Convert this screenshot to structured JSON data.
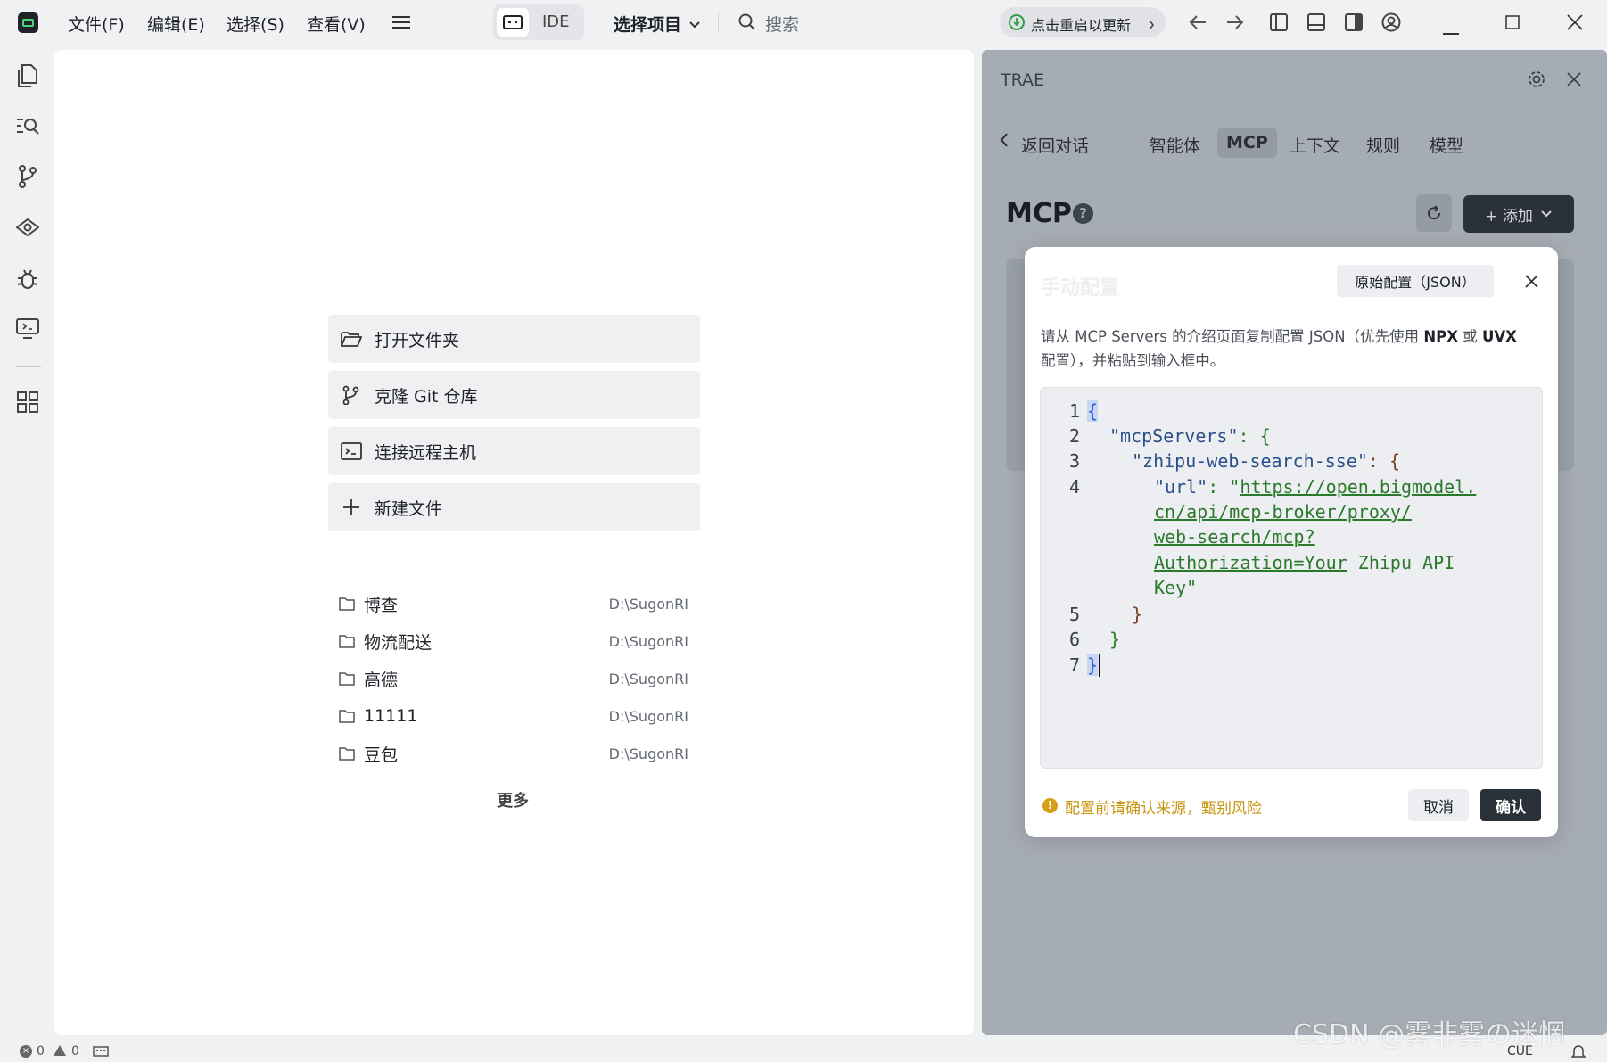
{
  "menu": {
    "file": "文件(F)",
    "edit": "编辑(E)",
    "select": "选择(S)",
    "view": "查看(V)"
  },
  "mode_switch": {
    "ide": "IDE"
  },
  "project_select": "选择项目",
  "search_placeholder": "搜索",
  "update_pill": "点击重启以更新",
  "editor": {
    "actions": [
      "打开文件夹",
      "克隆 Git 仓库",
      "连接远程主机",
      "新建文件"
    ],
    "recent": [
      {
        "name": "博查",
        "path": "D:\\SugonRI"
      },
      {
        "name": "物流配送",
        "path": "D:\\SugonRI"
      },
      {
        "name": "高德",
        "path": "D:\\SugonRI"
      },
      {
        "name": "11111",
        "path": "D:\\SugonRI"
      },
      {
        "name": "豆包",
        "path": "D:\\SugonRI"
      }
    ],
    "more": "更多"
  },
  "panel": {
    "title": "TRAE",
    "back": "返回对话",
    "tabs": [
      "智能体",
      "MCP",
      "上下文",
      "规则",
      "模型"
    ],
    "active_tab": "MCP",
    "heading": "MCP",
    "add_button": "+ 添加"
  },
  "modal": {
    "title": "手动配置",
    "raw_config_button": "原始配置（JSON）",
    "desc_part1": "请从 MCP Servers 的介绍页面复制配置 JSON（优先使用 ",
    "desc_npx": "NPX",
    "desc_or": " 或 ",
    "desc_uvx": "UVX",
    "desc_part2": "配置），并粘贴到输入框中。",
    "code": {
      "line_numbers": [
        "1",
        "2",
        "3",
        "4",
        "5",
        "6",
        "7"
      ],
      "l1": "{",
      "l2_key": "\"mcpServers\"",
      "l2_rest": ": {",
      "l3_key": "\"zhipu-web-search-sse\"",
      "l3_rest": ": {",
      "l4_key": "\"url\"",
      "l4_colon": ": \"",
      "url_line1": "https://open.bigmodel.",
      "url_line2": "cn/api/mcp-broker/proxy/",
      "url_line3": "web-search/mcp?",
      "url_line4a": "Authorization=Your",
      "url_line4b": " Zhipu API",
      "url_line5": "Key\"",
      "l5": "}",
      "l6": "}",
      "l7": "}"
    },
    "warning": "配置前请确认来源，甄别风险",
    "cancel": "取消",
    "confirm": "确认"
  },
  "status": {
    "errors": "0",
    "warnings": "0",
    "cue": "CUE"
  },
  "watermark": "CSDN @雾非雾の迷惘",
  "colors": {
    "accent_dark": "#2b3138",
    "warning": "#d4a017",
    "update_green": "#2ea043"
  }
}
